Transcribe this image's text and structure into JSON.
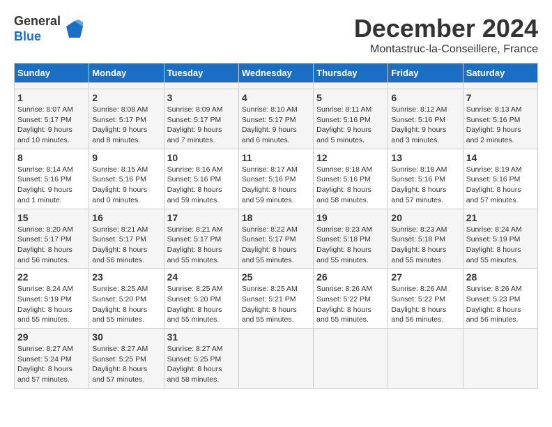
{
  "logo": {
    "general": "General",
    "blue": "Blue"
  },
  "header": {
    "month_title": "December 2024",
    "location": "Montastruc-la-Conseillere, France"
  },
  "calendar": {
    "days_of_week": [
      "Sunday",
      "Monday",
      "Tuesday",
      "Wednesday",
      "Thursday",
      "Friday",
      "Saturday"
    ],
    "weeks": [
      [
        {
          "day": "",
          "empty": true
        },
        {
          "day": "",
          "empty": true
        },
        {
          "day": "",
          "empty": true
        },
        {
          "day": "",
          "empty": true
        },
        {
          "day": "",
          "empty": true
        },
        {
          "day": "",
          "empty": true
        },
        {
          "day": "",
          "empty": true
        }
      ],
      [
        {
          "day": "1",
          "sunrise": "Sunrise: 8:07 AM",
          "sunset": "Sunset: 5:17 PM",
          "daylight": "Daylight: 9 hours and 10 minutes."
        },
        {
          "day": "2",
          "sunrise": "Sunrise: 8:08 AM",
          "sunset": "Sunset: 5:17 PM",
          "daylight": "Daylight: 9 hours and 8 minutes."
        },
        {
          "day": "3",
          "sunrise": "Sunrise: 8:09 AM",
          "sunset": "Sunset: 5:17 PM",
          "daylight": "Daylight: 9 hours and 7 minutes."
        },
        {
          "day": "4",
          "sunrise": "Sunrise: 8:10 AM",
          "sunset": "Sunset: 5:17 PM",
          "daylight": "Daylight: 9 hours and 6 minutes."
        },
        {
          "day": "5",
          "sunrise": "Sunrise: 8:11 AM",
          "sunset": "Sunset: 5:16 PM",
          "daylight": "Daylight: 9 hours and 5 minutes."
        },
        {
          "day": "6",
          "sunrise": "Sunrise: 8:12 AM",
          "sunset": "Sunset: 5:16 PM",
          "daylight": "Daylight: 9 hours and 3 minutes."
        },
        {
          "day": "7",
          "sunrise": "Sunrise: 8:13 AM",
          "sunset": "Sunset: 5:16 PM",
          "daylight": "Daylight: 9 hours and 2 minutes."
        }
      ],
      [
        {
          "day": "8",
          "sunrise": "Sunrise: 8:14 AM",
          "sunset": "Sunset: 5:16 PM",
          "daylight": "Daylight: 9 hours and 1 minute."
        },
        {
          "day": "9",
          "sunrise": "Sunrise: 8:15 AM",
          "sunset": "Sunset: 5:16 PM",
          "daylight": "Daylight: 9 hours and 0 minutes."
        },
        {
          "day": "10",
          "sunrise": "Sunrise: 8:16 AM",
          "sunset": "Sunset: 5:16 PM",
          "daylight": "Daylight: 8 hours and 59 minutes."
        },
        {
          "day": "11",
          "sunrise": "Sunrise: 8:17 AM",
          "sunset": "Sunset: 5:16 PM",
          "daylight": "Daylight: 8 hours and 59 minutes."
        },
        {
          "day": "12",
          "sunrise": "Sunrise: 8:18 AM",
          "sunset": "Sunset: 5:16 PM",
          "daylight": "Daylight: 8 hours and 58 minutes."
        },
        {
          "day": "13",
          "sunrise": "Sunrise: 8:18 AM",
          "sunset": "Sunset: 5:16 PM",
          "daylight": "Daylight: 8 hours and 57 minutes."
        },
        {
          "day": "14",
          "sunrise": "Sunrise: 8:19 AM",
          "sunset": "Sunset: 5:16 PM",
          "daylight": "Daylight: 8 hours and 57 minutes."
        }
      ],
      [
        {
          "day": "15",
          "sunrise": "Sunrise: 8:20 AM",
          "sunset": "Sunset: 5:17 PM",
          "daylight": "Daylight: 8 hours and 56 minutes."
        },
        {
          "day": "16",
          "sunrise": "Sunrise: 8:21 AM",
          "sunset": "Sunset: 5:17 PM",
          "daylight": "Daylight: 8 hours and 56 minutes."
        },
        {
          "day": "17",
          "sunrise": "Sunrise: 8:21 AM",
          "sunset": "Sunset: 5:17 PM",
          "daylight": "Daylight: 8 hours and 55 minutes."
        },
        {
          "day": "18",
          "sunrise": "Sunrise: 8:22 AM",
          "sunset": "Sunset: 5:17 PM",
          "daylight": "Daylight: 8 hours and 55 minutes."
        },
        {
          "day": "19",
          "sunrise": "Sunrise: 8:23 AM",
          "sunset": "Sunset: 5:18 PM",
          "daylight": "Daylight: 8 hours and 55 minutes."
        },
        {
          "day": "20",
          "sunrise": "Sunrise: 8:23 AM",
          "sunset": "Sunset: 5:18 PM",
          "daylight": "Daylight: 8 hours and 55 minutes."
        },
        {
          "day": "21",
          "sunrise": "Sunrise: 8:24 AM",
          "sunset": "Sunset: 5:19 PM",
          "daylight": "Daylight: 8 hours and 55 minutes."
        }
      ],
      [
        {
          "day": "22",
          "sunrise": "Sunrise: 8:24 AM",
          "sunset": "Sunset: 5:19 PM",
          "daylight": "Daylight: 8 hours and 55 minutes."
        },
        {
          "day": "23",
          "sunrise": "Sunrise: 8:25 AM",
          "sunset": "Sunset: 5:20 PM",
          "daylight": "Daylight: 8 hours and 55 minutes."
        },
        {
          "day": "24",
          "sunrise": "Sunrise: 8:25 AM",
          "sunset": "Sunset: 5:20 PM",
          "daylight": "Daylight: 8 hours and 55 minutes."
        },
        {
          "day": "25",
          "sunrise": "Sunrise: 8:25 AM",
          "sunset": "Sunset: 5:21 PM",
          "daylight": "Daylight: 8 hours and 55 minutes."
        },
        {
          "day": "26",
          "sunrise": "Sunrise: 8:26 AM",
          "sunset": "Sunset: 5:22 PM",
          "daylight": "Daylight: 8 hours and 55 minutes."
        },
        {
          "day": "27",
          "sunrise": "Sunrise: 8:26 AM",
          "sunset": "Sunset: 5:22 PM",
          "daylight": "Daylight: 8 hours and 56 minutes."
        },
        {
          "day": "28",
          "sunrise": "Sunrise: 8:26 AM",
          "sunset": "Sunset: 5:23 PM",
          "daylight": "Daylight: 8 hours and 56 minutes."
        }
      ],
      [
        {
          "day": "29",
          "sunrise": "Sunrise: 8:27 AM",
          "sunset": "Sunset: 5:24 PM",
          "daylight": "Daylight: 8 hours and 57 minutes."
        },
        {
          "day": "30",
          "sunrise": "Sunrise: 8:27 AM",
          "sunset": "Sunset: 5:25 PM",
          "daylight": "Daylight: 8 hours and 57 minutes."
        },
        {
          "day": "31",
          "sunrise": "Sunrise: 8:27 AM",
          "sunset": "Sunset: 5:25 PM",
          "daylight": "Daylight: 8 hours and 58 minutes."
        },
        {
          "day": "",
          "empty": true
        },
        {
          "day": "",
          "empty": true
        },
        {
          "day": "",
          "empty": true
        },
        {
          "day": "",
          "empty": true
        }
      ]
    ]
  }
}
